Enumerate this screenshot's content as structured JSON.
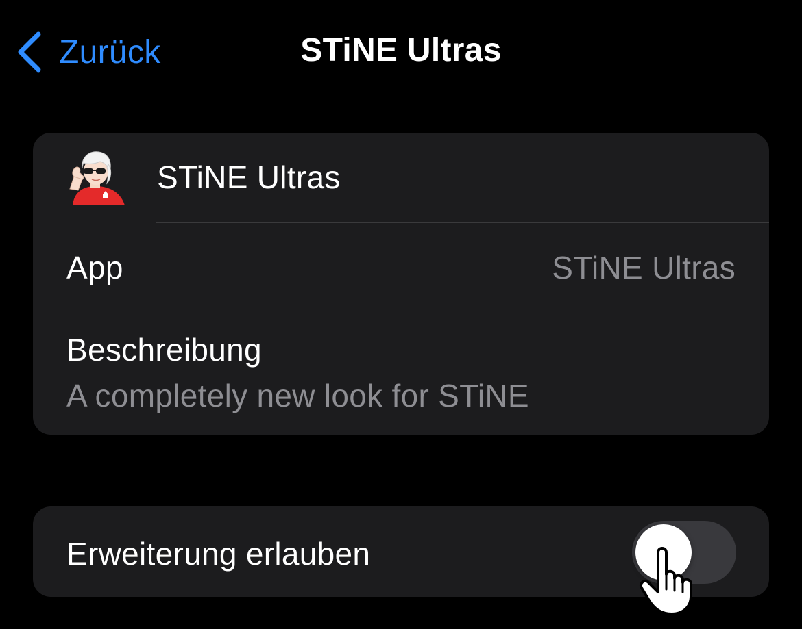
{
  "nav": {
    "back_label": "Zurück",
    "title": "STiNE Ultras"
  },
  "extension": {
    "name": "STiNE Ultras",
    "icon": "stine-ultras-avatar-icon",
    "app_label": "App",
    "app_value": "STiNE Ultras",
    "description_label": "Beschreibung",
    "description_value": "A completely new look for STiNE"
  },
  "permission": {
    "label": "Erweiterung erlauben",
    "enabled": false
  },
  "colors": {
    "accent": "#2f8cff",
    "background": "#000000",
    "card": "#1c1c1e",
    "secondary_text": "#8e8e93",
    "toggle_off": "#39393d"
  }
}
